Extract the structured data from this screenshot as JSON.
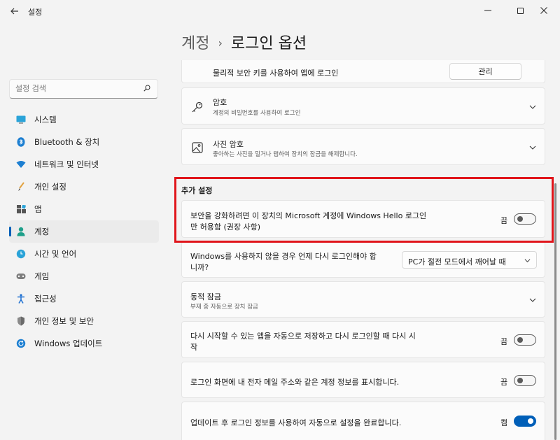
{
  "window": {
    "app_title": "설정",
    "back_icon": "back-arrow-icon",
    "minimize_label": "─",
    "close_label": "✕"
  },
  "search": {
    "placeholder": "설정 검색",
    "value": "",
    "icon": "search-icon"
  },
  "sidebar": {
    "items": [
      {
        "label": "시스템",
        "icon": "monitor-icon",
        "active": false
      },
      {
        "label": "Bluetooth & 장치",
        "icon": "bluetooth-icon",
        "active": false
      },
      {
        "label": "네트워크 및 인터넷",
        "icon": "wifi-icon",
        "active": false
      },
      {
        "label": "개인 설정",
        "icon": "brush-icon",
        "active": false
      },
      {
        "label": "앱",
        "icon": "apps-icon",
        "active": false
      },
      {
        "label": "계정",
        "icon": "person-icon",
        "active": true
      },
      {
        "label": "시간 및 언어",
        "icon": "globe-clock-icon",
        "active": false
      },
      {
        "label": "게임",
        "icon": "gamepad-icon",
        "active": false
      },
      {
        "label": "접근성",
        "icon": "accessibility-icon",
        "active": false
      },
      {
        "label": "개인 정보 및 보안",
        "icon": "shield-icon",
        "active": false
      },
      {
        "label": "Windows 업데이트",
        "icon": "update-icon",
        "active": false
      }
    ]
  },
  "header": {
    "parent": "계정",
    "separator": "›",
    "title": "로그인 옵션"
  },
  "security_key": {
    "title": "물리적 보안 키를 사용하여 앱에 로그인",
    "button_label": "관리"
  },
  "password": {
    "title": "암호",
    "subtitle": "계정의 비밀번호를 사용하여 로그인",
    "icon": "key-icon"
  },
  "picture_password": {
    "title": "사진 암호",
    "subtitle": "좋아하는 사진을 밀거나 탭하여 장치의 잠금을 해제합니다.",
    "icon": "image-icon"
  },
  "additional": {
    "section_title": "추가 설정",
    "hello_only": {
      "line1": "보안을 강화하려면 이 장치의 Microsoft 계정에 Windows Hello 로그인",
      "line2": "만 허용함 (권장 사항)",
      "state_label": "끔",
      "on": false
    },
    "signin_required": {
      "line1": "Windows를 사용하지 않을 경우 언제 다시 로그인해야 합",
      "line2": "니까?",
      "selected": "PC가 절전 모드에서 깨어날 때"
    },
    "dynamic_lock": {
      "title": "동적 잠금",
      "subtitle": "부재 중 자동으로 장치 잠금"
    },
    "restart_apps": {
      "line1": "다시 시작할 수 있는 앱을 자동으로 저장하고 다시 로그인할 때 다시 시",
      "line2": "작",
      "state_label": "끔",
      "on": false
    },
    "show_account": {
      "title": "로그인 화면에 내 전자 메일 주소와 같은 계정 정보를 표시합니다.",
      "state_label": "끔",
      "on": false
    },
    "auto_finish": {
      "title": "업데이트 후 로그인 정보를 사용하여 자동으로 설정을 완료합니다.",
      "state_label": "켬",
      "on": true
    }
  },
  "colors": {
    "accent": "#005fb8",
    "highlight_border": "#e0151b"
  }
}
